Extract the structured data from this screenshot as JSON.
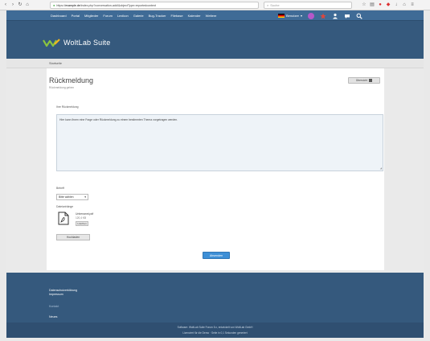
{
  "browser": {
    "url_prefix": "https://",
    "url_host": "example.de",
    "url_path": "/index.php?conversation-add/&objectType=reportedcontent",
    "search_placeholder": "Suche"
  },
  "header": {
    "menu": [
      "Dashboard",
      "Portal",
      "Mitglieder",
      "Forum",
      "Lexikon",
      "Galerie",
      "Bug-Tracker",
      "Filebase",
      "Kalender",
      "Weitere"
    ],
    "user_name": "Benutzer",
    "logo_text": "WoltLab Suite"
  },
  "breadcrumb": "Startseite",
  "content": {
    "title": "Rückmeldung",
    "subtitle": "Rückmeldung geben",
    "overview_button": "Übersicht",
    "message_label": "Ihre Rückmeldung",
    "message_text": "Hier kann Ihnen eine Frage oder Rückmeldung zu einem bestimmten Thema vorgetragen werden.",
    "reason_label": "Betreff",
    "reason_value": "Bitte wählen",
    "attachments_label": "Dateianhänge",
    "file_name": "Unbenannt.pdf",
    "file_size": "120,4 KB",
    "delete_label": "Löschen",
    "upload_label": "Hochladen",
    "submit_label": "Absenden"
  },
  "footer": {
    "link_1": "Datenschutzerklärung",
    "link_2": "Impressum",
    "link_3": "Kontakt",
    "link_4": "Neues",
    "copyright_1": "Software: WoltLab Suite Forum 5.x, entwickelt von WoltLab GmbH",
    "copyright_2": "Lizenziert für die Demo · Seite in 0,1 Sekunden generiert"
  },
  "colors": {
    "header": "#35597d",
    "menubar": "#3f6b96",
    "accent": "#3d8fd6",
    "logo_green": "#8bc43f"
  }
}
